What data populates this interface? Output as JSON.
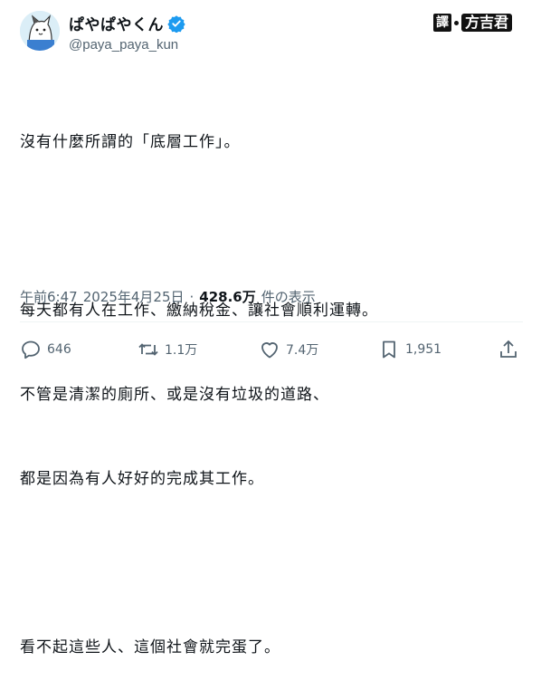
{
  "author": {
    "display_name": "ぱやぱやくん",
    "handle": "@paya_paya_kun",
    "verified": true,
    "avatar": "cat-avatar"
  },
  "credit": {
    "label": "譯",
    "name": "方吉君"
  },
  "tweet": {
    "lines": [
      "沒有什麼所謂的「底層工作」。",
      "",
      "每天都有人在工作、繳納稅金、讓社會順利運轉。",
      "不管是清潔的廁所、或是沒有垃圾的道路、",
      "都是因為有人好好的完成其工作。",
      "",
      "看不起這些人、這個社會就完蛋了。"
    ]
  },
  "meta": {
    "time": "午前6:47",
    "date": "2025年4月25日",
    "separator": "·",
    "views": "428.6万",
    "views_label": "件の表示"
  },
  "actions": {
    "reply_count": "646",
    "retweet_count": "1.1万",
    "like_count": "7.4万",
    "bookmark_count": "1,951"
  },
  "colors": {
    "verified": "#1d9bf0",
    "secondary_text": "#536471"
  }
}
